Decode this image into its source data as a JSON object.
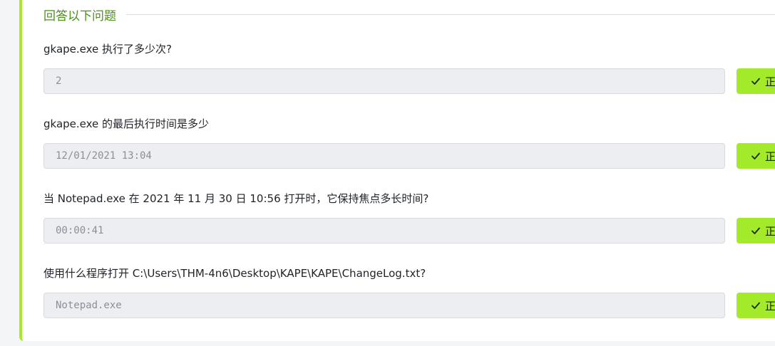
{
  "section": {
    "title": "回答以下问题"
  },
  "questions": [
    {
      "label": "gkape.exe 执行了多少次?",
      "answer": "2",
      "button_label": "正"
    },
    {
      "label": "gkape.exe 的最后执行时间是多少",
      "answer": "12/01/2021 13:04",
      "button_label": "正"
    },
    {
      "label": "当 Notepad.exe 在 2021 年 11 月 30 日 10:56 打开时，它保持焦点多长时间?",
      "answer": "00:00:41",
      "button_label": "正"
    },
    {
      "label": "使用什么程序打开 C:\\Users\\THM-4n6\\Desktop\\KAPE\\KAPE\\ChangeLog.txt?",
      "answer": "Notepad.exe",
      "button_label": "正"
    }
  ],
  "icons": {
    "button_icon": "check-icon"
  },
  "colors": {
    "accent": "#a3ea2a",
    "title": "#4a8f1c",
    "input_bg": "#eceef1"
  }
}
